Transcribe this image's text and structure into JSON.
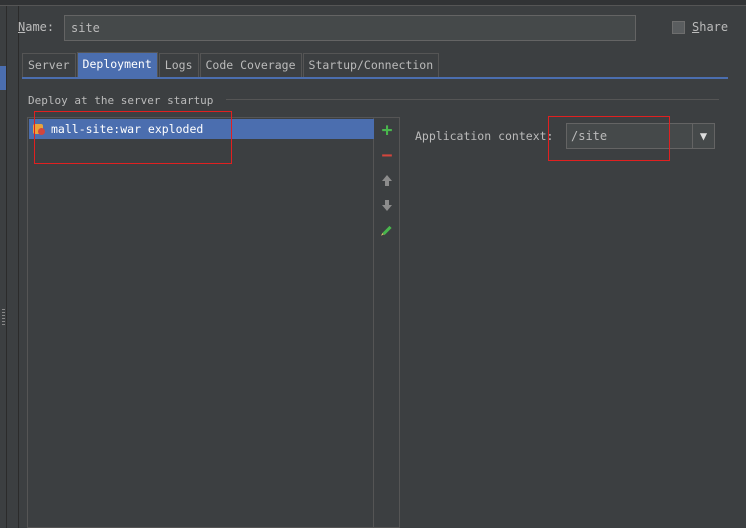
{
  "run_config": {
    "name_label_prefix": "",
    "name_label_mnemonic": "N",
    "name_label_rest": "ame:",
    "name_value": "site",
    "share_mnemonic": "S",
    "share_rest": "hare",
    "share_checked": false
  },
  "tabs": [
    {
      "label": "Server",
      "active": false
    },
    {
      "label": "Deployment",
      "active": true
    },
    {
      "label": "Logs",
      "active": false
    },
    {
      "label": "Code Coverage",
      "active": false
    },
    {
      "label": "Startup/Connection",
      "active": false
    }
  ],
  "deployment": {
    "section_title": "Deploy at the server startup",
    "artifacts": [
      {
        "label": "mall-site:war exploded",
        "icon": "war-exploded-icon",
        "selected": true
      }
    ],
    "toolbar": {
      "add_glyph": "+",
      "remove_glyph": "−",
      "icons": [
        "add-icon",
        "remove-icon",
        "move-up-icon",
        "move-down-icon",
        "edit-icon"
      ]
    },
    "application_context_label": "Application context:",
    "application_context_value": "/site",
    "combo_arrow_glyph": "▼"
  },
  "colors": {
    "background": "#3c3f41",
    "selection": "#4b6eaf",
    "annotation_red": "#e02020",
    "add_green": "#49b64d",
    "remove_red": "#d2463d"
  }
}
